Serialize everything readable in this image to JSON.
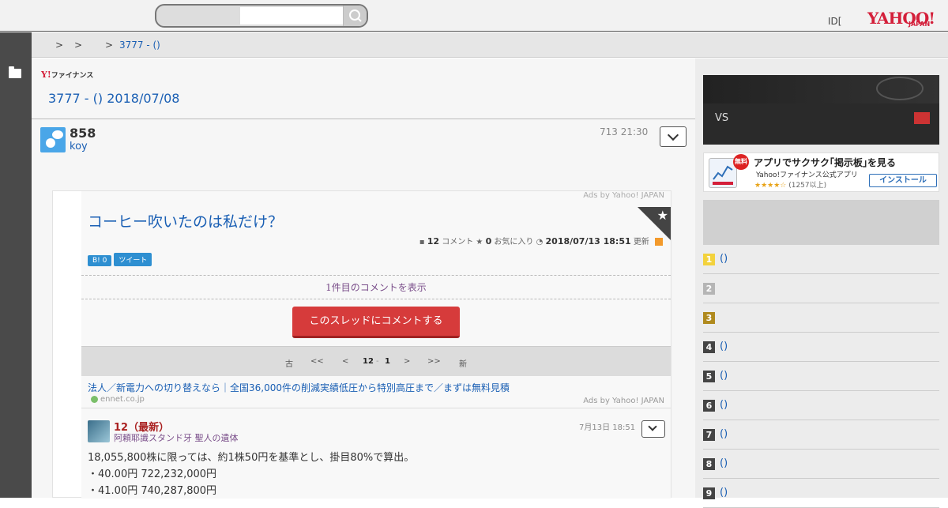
{
  "header": {
    "search_placeholder": "",
    "id_text": "ID[",
    "logo_text": "YAHOO!",
    "logo_sub": "JAPAN"
  },
  "breadcrumb": {
    "sep1": ">",
    "sep2": ">",
    "sep3": ">",
    "current": "3777 - ()"
  },
  "main": {
    "finance_logo_y": "Y!",
    "finance_logo_text": "ファイナンス",
    "title": "3777 - () 2018/07/08",
    "post": {
      "number": "858",
      "user": "koy",
      "time": "713 21:30"
    }
  },
  "embed": {
    "ads_label": "Ads by Yahoo! JAPAN",
    "thread_title": "コーヒー吹いたのは私だけ？",
    "meta_comments": "12",
    "meta_comments_label": "コメント",
    "meta_fav": "0",
    "meta_fav_label": "お気に入り",
    "meta_updated": "2018/07/13 18:51",
    "meta_updated_label": "更新",
    "social_hatena": "B! 0",
    "social_tweet": "ツイート",
    "show_first": "1件目のコメントを表示",
    "comment_button": "このスレッドにコメントする",
    "pager": {
      "oldest": "古",
      "prev_many": "<<",
      "prev": "<",
      "current": "12",
      "dash": "-",
      "current_end": "1",
      "next": ">",
      "next_many": ">>",
      "newest": "新"
    },
    "ad_text": "法人／新電力への切り替えなら｜全国36,000件の削減実績低圧から特別高圧まで／まずは無料見積",
    "ad_url": "ennet.co.jp",
    "ad_by": "Ads by Yahoo! JAPAN",
    "comment": {
      "number": "12（最新）",
      "user": "阿頼耶識スタンド牙 聖人の遺体",
      "time": "7月13日 18:51",
      "lines": [
        "18,055,800株に限っては、約1株50円を基準とし、掛目80%で算出。",
        "・40.00円 722,232,000円",
        "・41.00円 740,287,800円"
      ]
    }
  },
  "sidebar": {
    "banner_vs": "VS",
    "app_badge": "無料",
    "app_title": "アプリでサクサク｢掲示板｣を見る",
    "app_sub": "Yahoo!ファイナンス公式アプリ",
    "app_stars": "★★★★☆",
    "app_count": "(1257以上)",
    "install": "インストール",
    "rankings": [
      {
        "n": "1",
        "text": "()",
        "color": "#f3d23c"
      },
      {
        "n": "2",
        "text": "",
        "color": "#b5b5b5"
      },
      {
        "n": "3",
        "text": "",
        "color": "#b08a1e"
      },
      {
        "n": "4",
        "text": "()",
        "color": "#444444"
      },
      {
        "n": "5",
        "text": "()",
        "color": "#444444"
      },
      {
        "n": "6",
        "text": "()",
        "color": "#444444"
      },
      {
        "n": "7",
        "text": "()",
        "color": "#444444"
      },
      {
        "n": "8",
        "text": "()",
        "color": "#444444"
      },
      {
        "n": "9",
        "text": "()",
        "color": "#444444"
      }
    ]
  }
}
